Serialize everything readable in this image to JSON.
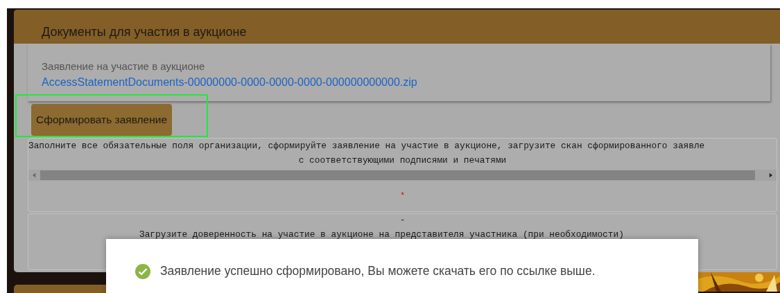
{
  "panel": {
    "title": "Документы для участия в аукционе"
  },
  "application": {
    "label": "Заявление на участие в аукционе",
    "file_link": "AccessStatementDocuments-00000000-0000-0000-0000-000000000000.zip"
  },
  "generate_button": {
    "label": "Сформировать заявление",
    "highlighted": true
  },
  "instruction": {
    "lines": [
      "Заполните все обязательные поля организации, сформируйте заявление на участие в аукционе, загрузите скан сформированного заявле",
      "с соответствующими подписями и печатями"
    ],
    "required_mark": "*"
  },
  "power_of_attorney": {
    "dash": "-",
    "text": "Загрузите доверенность на участие в аукционе на представителя участника (при необходимости)"
  },
  "toast": {
    "kind": "success",
    "message": "Заявление успешно сформировано, Вы можете скачать его по ссылке выше."
  }
}
